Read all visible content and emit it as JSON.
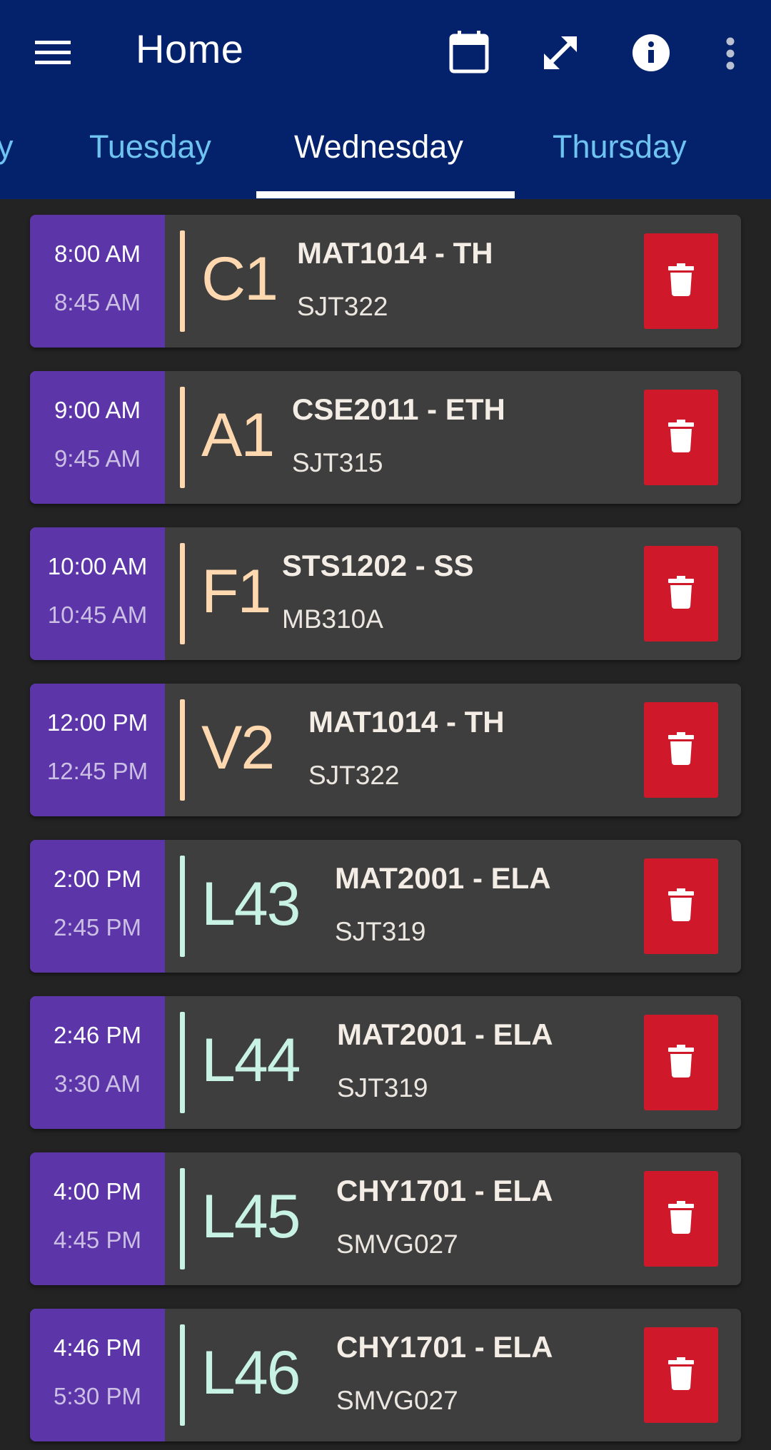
{
  "header": {
    "title": "Home",
    "icons": [
      "menu-icon",
      "calendar-icon",
      "fullscreen-icon",
      "info-icon",
      "more-vert-icon"
    ]
  },
  "tabs": [
    {
      "label": "y"
    },
    {
      "label": "Tuesday"
    },
    {
      "label": "Wednesday",
      "active": true
    },
    {
      "label": "Thursday"
    }
  ],
  "colors": {
    "appbar": "#03226b",
    "tab_inactive": "#6ec3f0",
    "time_box": "#5c35a8",
    "delete": "#d0182b",
    "theory_slot": "#ffd8b0",
    "lab_slot": "#c7f2e4"
  },
  "entries": [
    {
      "start": "8:00 AM",
      "end": "8:45 AM",
      "slot": "C1",
      "course": "MAT1014 - TH",
      "room": "SJT322",
      "kind": "theory"
    },
    {
      "start": "9:00 AM",
      "end": "9:45 AM",
      "slot": "A1",
      "course": "CSE2011 - ETH",
      "room": "SJT315",
      "kind": "theory"
    },
    {
      "start": "10:00 AM",
      "end": "10:45 AM",
      "slot": "F1",
      "course": "STS1202 - SS",
      "room": "MB310A",
      "kind": "theory"
    },
    {
      "start": "12:00 PM",
      "end": "12:45 PM",
      "slot": "V2",
      "course": "MAT1014 - TH",
      "room": "SJT322",
      "kind": "theory"
    },
    {
      "start": "2:00 PM",
      "end": "2:45 PM",
      "slot": "L43",
      "course": "MAT2001 - ELA",
      "room": "SJT319",
      "kind": "lab"
    },
    {
      "start": "2:46 PM",
      "end": "3:30 AM",
      "slot": "L44",
      "course": "MAT2001 - ELA",
      "room": "SJT319",
      "kind": "lab"
    },
    {
      "start": "4:00 PM",
      "end": "4:45 PM",
      "slot": "L45",
      "course": "CHY1701 - ELA",
      "room": "SMVG027",
      "kind": "lab"
    },
    {
      "start": "4:46 PM",
      "end": "5:30 PM",
      "slot": "L46",
      "course": "CHY1701 - ELA",
      "room": "SMVG027",
      "kind": "lab"
    }
  ]
}
